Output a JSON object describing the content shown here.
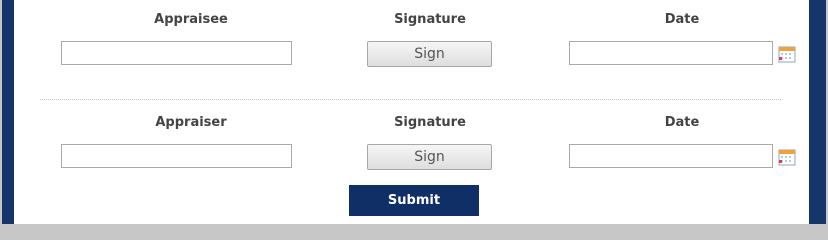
{
  "section1": {
    "person_label": "Appraisee",
    "signature_label": "Signature",
    "date_label": "Date",
    "person_value": "",
    "date_value": "",
    "sign_button": "Sign"
  },
  "section2": {
    "person_label": "Appraiser",
    "signature_label": "Signature",
    "date_label": "Date",
    "person_value": "",
    "date_value": "",
    "sign_button": "Sign"
  },
  "submit_label": "Submit",
  "icons": {
    "date_picker": "calendar-icon"
  },
  "colors": {
    "frame": "#16356b",
    "submit": "#0f2f66"
  }
}
